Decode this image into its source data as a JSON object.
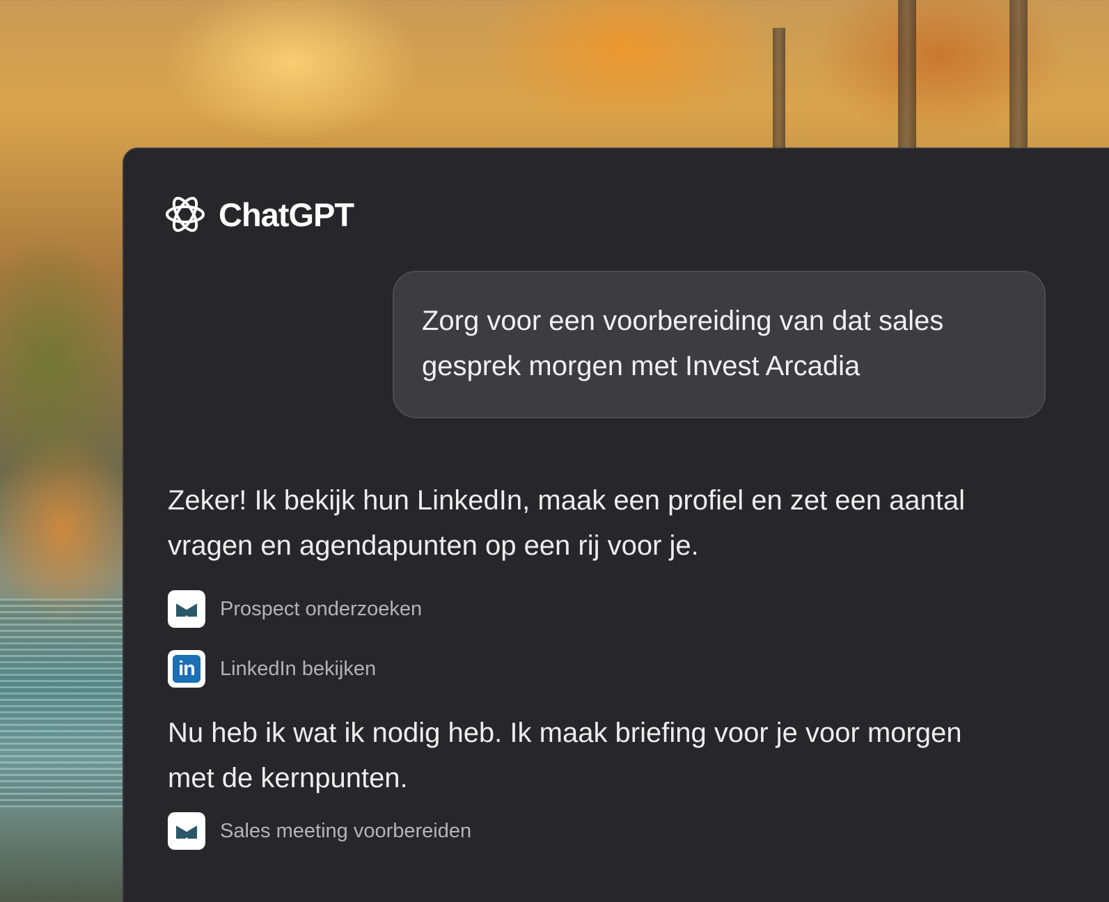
{
  "app": {
    "title": "ChatGPT",
    "logo_icon": "openai-logo-icon"
  },
  "conversation": {
    "user_message": "Zorg voor een voorbereiding van dat sales gesprek morgen met Invest Arcadia",
    "assistant_messages": [
      "Zeker! Ik bekijk hun LinkedIn, maak een profiel en zet een aantal vragen en agendapunten op een rij voor je.",
      "Nu heb ik wat ik nodig heb. Ik maak briefing voor je voor morgen met de kernpunten."
    ],
    "tool_steps": [
      {
        "label": "Prospect onderzoeken",
        "icon": "notebook-icon"
      },
      {
        "label": "LinkedIn bekijken",
        "icon": "linkedin-icon",
        "icon_text": "in"
      },
      {
        "label": "Sales meeting voorbereiden",
        "icon": "notebook-icon"
      }
    ]
  },
  "colors": {
    "panel_background": "#27272b",
    "user_bubble": "#3c3c41",
    "linkedin_blue": "#1a6fb5",
    "notebook_icon": "#2a5868"
  }
}
